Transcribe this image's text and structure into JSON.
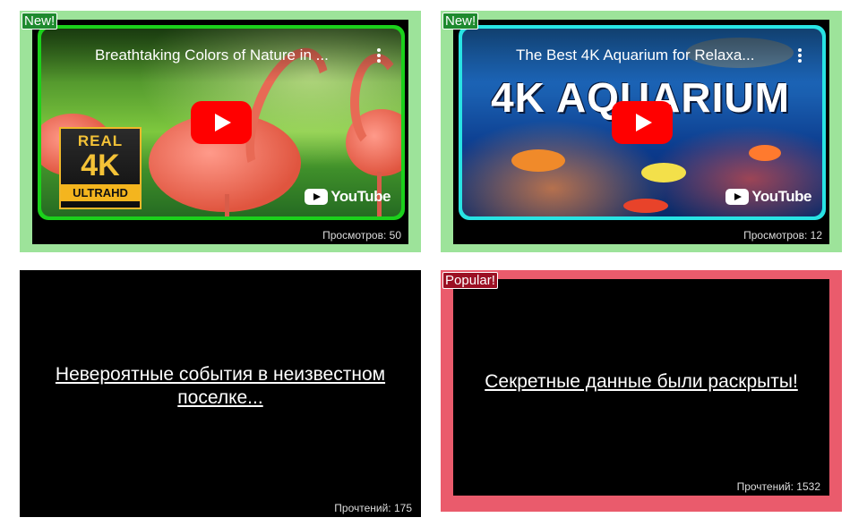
{
  "cards": [
    {
      "badge": "New!",
      "video_title": "Breathtaking Colors of Nature in ...",
      "overlay_logo": [
        "REAL",
        "4K",
        "ULTRAHD"
      ],
      "yt_label": "YouTube",
      "views": "Просмотров: 50"
    },
    {
      "badge": "New!",
      "video_title": "The Best 4K Aquarium for Relaxa...",
      "overlay_text": "4K AQUARIUM",
      "yt_label": "YouTube",
      "views": "Просмотров: 12"
    },
    {
      "headline": "Невероятные события в неизвестном поселке...",
      "reads": "Прочтений: 175"
    },
    {
      "badge": "Popular!",
      "headline": "Секретные данные были раскрыты!",
      "reads": "Прочтений: 1532"
    }
  ],
  "colors": {
    "new_frame": "#9de39a",
    "popular_frame": "#ea5b6c",
    "new_badge": "#1e8a2e",
    "popular_badge": "#9b1023",
    "play_button": "#ff0000"
  },
  "icons": [
    "play-icon",
    "more-vert-icon",
    "youtube-logo-icon"
  ]
}
